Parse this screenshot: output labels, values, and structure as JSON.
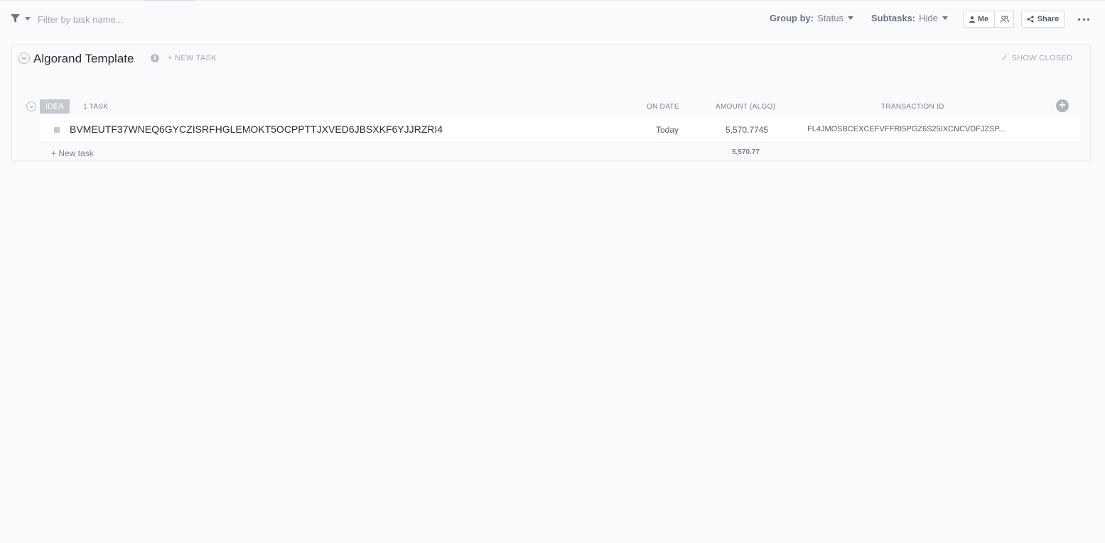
{
  "toolbar": {
    "filter_placeholder": "Filter by task name...",
    "group_by_label": "Group by:",
    "group_by_value": "Status",
    "subtasks_label": "Subtasks:",
    "subtasks_value": "Hide",
    "me_label": "Me",
    "share_label": "Share",
    "icons": [
      "filter-icon",
      "chevron-down-icon",
      "user-icon",
      "team-icon",
      "share-icon",
      "more-icon"
    ]
  },
  "list": {
    "title": "Algorand Template",
    "new_task_label": "+ NEW TASK",
    "show_closed_label": "SHOW CLOSED",
    "groups": [
      {
        "status": "IDEA",
        "status_color": "#c4c9d0",
        "task_count": "1 TASK",
        "columns": {
          "on_date": "ON DATE",
          "amount": "AMOUNT (ALGO)",
          "transaction_id": "TRANSACTION ID"
        },
        "tasks": [
          {
            "name": "BVMEUTF37WNEQ6GYCZISRFHGLEMOKT5OCPPTTJXVED6JBSXKF6YJJRZRI4",
            "on_date": "Today",
            "amount": "5,570.7745",
            "transaction_id": "FL4JMOSBCEXCEFVFFRI5PGZ6S25IXCNCVDFJZSP..."
          }
        ],
        "new_task_label": "+ New task",
        "amount_sum": "5,570.77"
      }
    ]
  },
  "colors": {
    "background": "#f9fafc",
    "status_idea": "#c4c9d0",
    "muted_text": "#7c828d"
  }
}
